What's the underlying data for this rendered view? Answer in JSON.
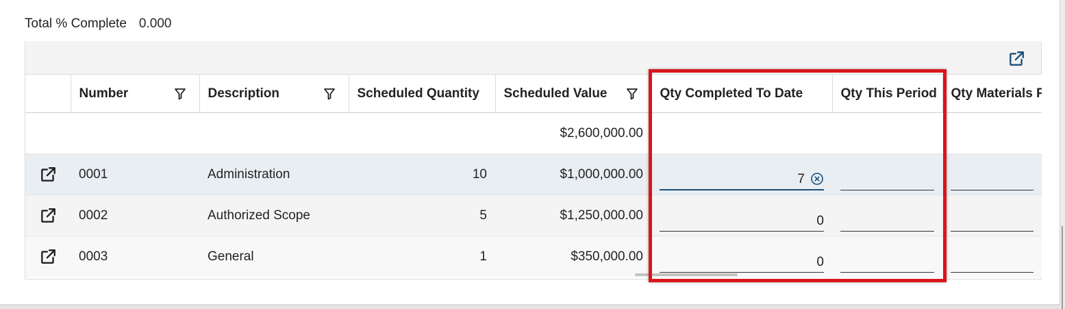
{
  "summary": {
    "label": "Total % Complete",
    "value": "0.000"
  },
  "toolbar": {
    "export_icon": "open-in-new-icon"
  },
  "columns": [
    {
      "label": "",
      "filter": false
    },
    {
      "label": "Number",
      "filter": true
    },
    {
      "label": "Description",
      "filter": true
    },
    {
      "label": "Scheduled Quantity",
      "filter": false
    },
    {
      "label": "Scheduled Value",
      "filter": true
    },
    {
      "label": "Qty Completed To Date",
      "filter": false
    },
    {
      "label": "Qty This Period",
      "filter": false
    },
    {
      "label": "Qty Materials P",
      "filter": false
    }
  ],
  "totals_row": {
    "scheduled_value": "$2,600,000.00"
  },
  "rows": [
    {
      "number": "0001",
      "description": "Administration",
      "scheduled_quantity": "10",
      "scheduled_value": "$1,000,000.00",
      "qty_completed": "7",
      "qty_this_period": "",
      "qty_materials": ""
    },
    {
      "number": "0002",
      "description": "Authorized Scope",
      "scheduled_quantity": "5",
      "scheduled_value": "$1,250,000.00",
      "qty_completed": "0",
      "qty_this_period": "",
      "qty_materials": ""
    },
    {
      "number": "0003",
      "description": "General",
      "scheduled_quantity": "1",
      "scheduled_value": "$350,000.00",
      "qty_completed": "0",
      "qty_this_period": "",
      "qty_materials": ""
    }
  ],
  "colors": {
    "highlight": "#d8161b",
    "active_underline": "#1b4f7a",
    "icon": "#1b4f7a"
  }
}
